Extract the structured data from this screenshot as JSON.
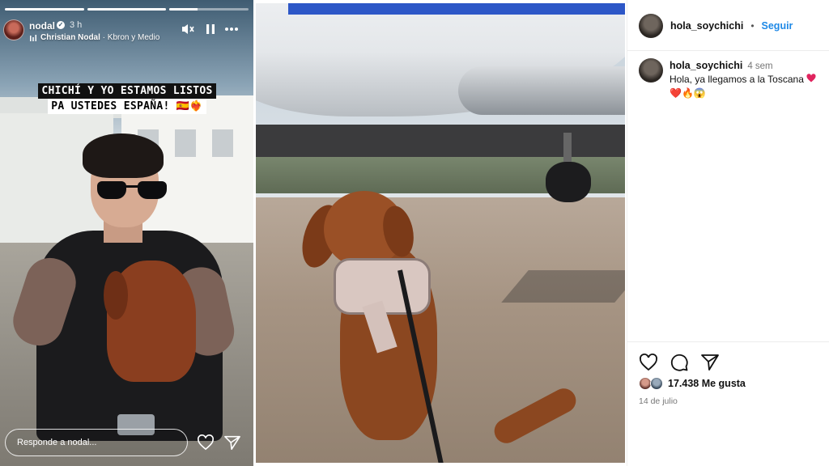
{
  "story": {
    "username": "nodal",
    "time": "3 h",
    "song_artist": "Christian Nodal",
    "song_title": "Kbron y Medio",
    "caption_line1": "CHICHÍ Y YO ESTAMOS LISTOS",
    "caption_line2": "PA USTEDES ESPAÑA! 🇪🇸❤️‍🔥",
    "reply_placeholder": "Responde a nodal...",
    "progress": [
      1.0,
      1.0,
      0.35
    ],
    "icons": [
      "verified-badge-icon",
      "music-bars-icon",
      "mute-icon",
      "pause-icon",
      "more-icon",
      "heart-icon",
      "send-icon"
    ]
  },
  "post": {
    "username": "hola_soychichi",
    "follow_label": "Seguir",
    "separator": "•",
    "comment": {
      "username": "hola_soychichi",
      "time": "4 sem",
      "text": "Hola, ya llegamos a la Toscana",
      "emojis": "❤️🔥😱"
    },
    "likes": "17.438 Me gusta",
    "date": "14 de julio",
    "icons": [
      "heart-icon",
      "comment-icon",
      "share-icon"
    ]
  },
  "colors": {
    "follow": "#1f89e6",
    "heart": "#e0245e",
    "story_caption_bg": "#111111"
  }
}
